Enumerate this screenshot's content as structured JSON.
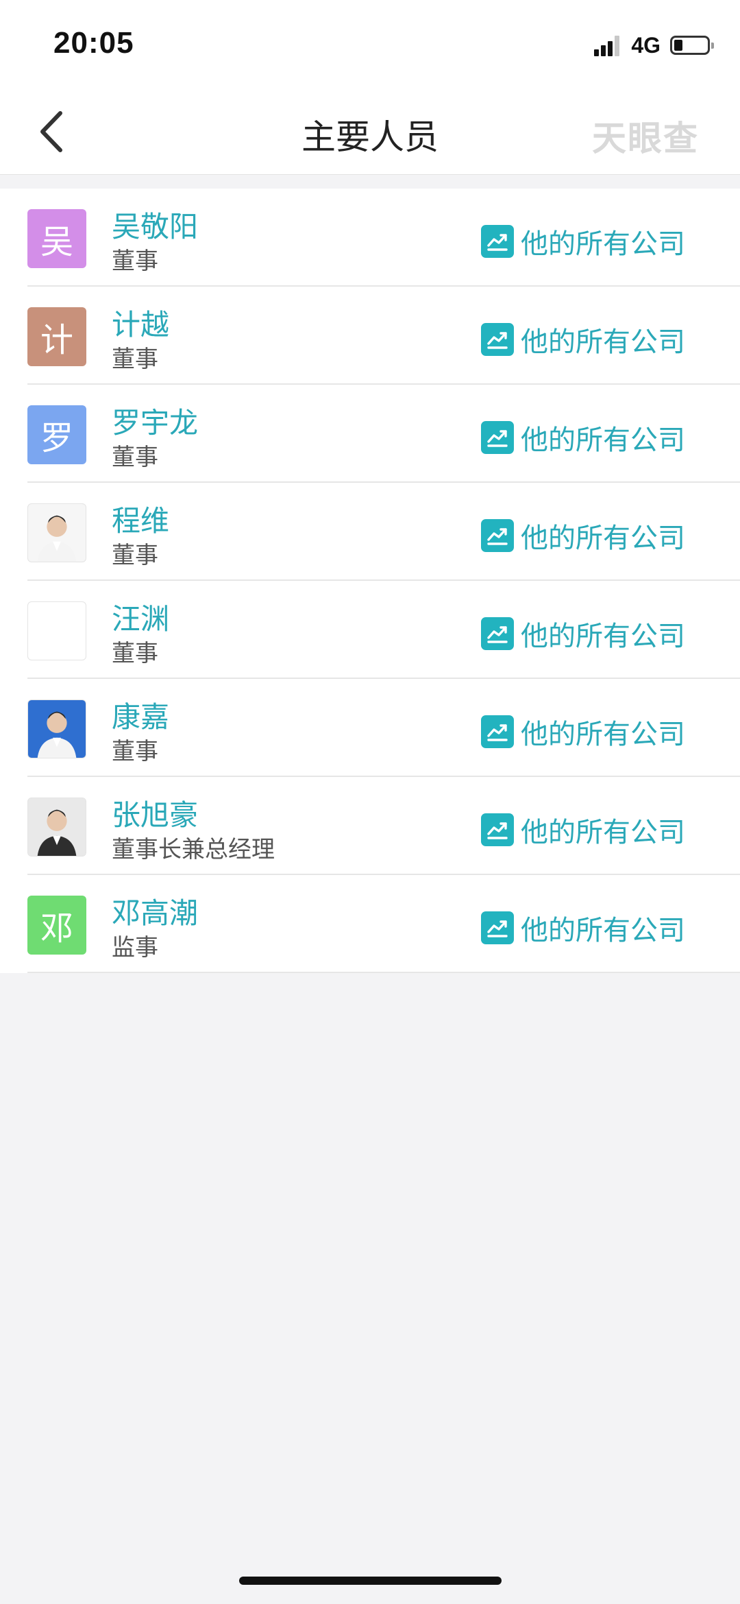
{
  "status_bar": {
    "time": "20:05",
    "network": "4G",
    "signal_bars": 4,
    "signal_active": 3,
    "battery_level": 0.25
  },
  "nav": {
    "title": "主要人员",
    "brand": "天眼查",
    "back_icon": "chevron-left-icon"
  },
  "colors": {
    "accent": "#2aa8b8",
    "icon_bg": "#22b3bf"
  },
  "people": [
    {
      "name": "吴敬阳",
      "role": "董事",
      "avatar_char": "吴",
      "avatar_color": "#d38ee8",
      "avatar_type": "initial",
      "link_label": "他的所有公司"
    },
    {
      "name": "计越",
      "role": "董事",
      "avatar_char": "计",
      "avatar_color": "#c8917b",
      "avatar_type": "initial",
      "link_label": "他的所有公司"
    },
    {
      "name": "罗宇龙",
      "role": "董事",
      "avatar_char": "罗",
      "avatar_color": "#7ba6f0",
      "avatar_type": "initial",
      "link_label": "他的所有公司"
    },
    {
      "name": "程维",
      "role": "董事",
      "avatar_char": "",
      "avatar_color": "#f6f6f6",
      "avatar_type": "photo",
      "link_label": "他的所有公司"
    },
    {
      "name": "汪渊",
      "role": "董事",
      "avatar_char": "",
      "avatar_color": "#ffffff",
      "avatar_type": "empty",
      "link_label": "他的所有公司"
    },
    {
      "name": "康嘉",
      "role": "董事",
      "avatar_char": "",
      "avatar_color": "#2f6fd0",
      "avatar_type": "photo",
      "link_label": "他的所有公司"
    },
    {
      "name": "张旭豪",
      "role": "董事长兼总经理",
      "avatar_char": "",
      "avatar_color": "#e9e9e9",
      "avatar_type": "photo",
      "link_label": "他的所有公司"
    },
    {
      "name": "邓高潮",
      "role": "监事",
      "avatar_char": "邓",
      "avatar_color": "#6fdc72",
      "avatar_type": "initial",
      "link_label": "他的所有公司"
    }
  ]
}
